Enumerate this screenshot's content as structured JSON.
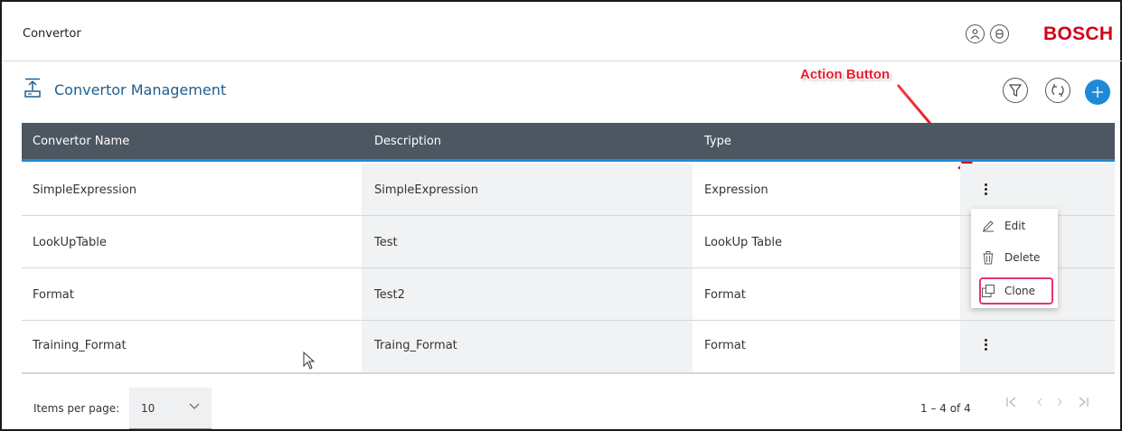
{
  "app": {
    "title": "Convertor",
    "brand": "BOSCH"
  },
  "header_icons": [
    "user-icon",
    "help-icon"
  ],
  "section": {
    "title": "Convertor Management"
  },
  "annotation": {
    "label": "Action Button",
    "color": "#ea1d2c"
  },
  "toolbar": {
    "icons": [
      "filter-icon",
      "refresh-icon",
      "add-icon"
    ],
    "accent": "#1e8ad6"
  },
  "table": {
    "columns": [
      "Convertor Name",
      "Description",
      "Type"
    ],
    "rows": [
      {
        "name": "SimpleExpression",
        "description": "SimpleExpression",
        "type": "Expression"
      },
      {
        "name": "LookUpTable",
        "description": "Test",
        "type": "LookUp Table"
      },
      {
        "name": "Format",
        "description": "Test2",
        "type": "Format"
      },
      {
        "name": "Training_Format",
        "description": "Traing_Format",
        "type": "Format"
      }
    ]
  },
  "action_menu": {
    "items": [
      {
        "label": "Edit",
        "icon": "pencil-icon"
      },
      {
        "label": "Delete",
        "icon": "trash-icon"
      },
      {
        "label": "Clone",
        "icon": "clone-icon"
      }
    ],
    "highlight_color": "#e8336d"
  },
  "pagination": {
    "items_per_page_label": "Items per page:",
    "items_per_page_value": "10",
    "range": "1 – 4 of 4",
    "controls": [
      "first-page-icon",
      "previous-page-icon",
      "next-page-icon",
      "last-page-icon"
    ]
  },
  "colors": {
    "header_bg": "#4d5762",
    "brand_red": "#d0021b",
    "title_blue": "#1f5e8f"
  }
}
